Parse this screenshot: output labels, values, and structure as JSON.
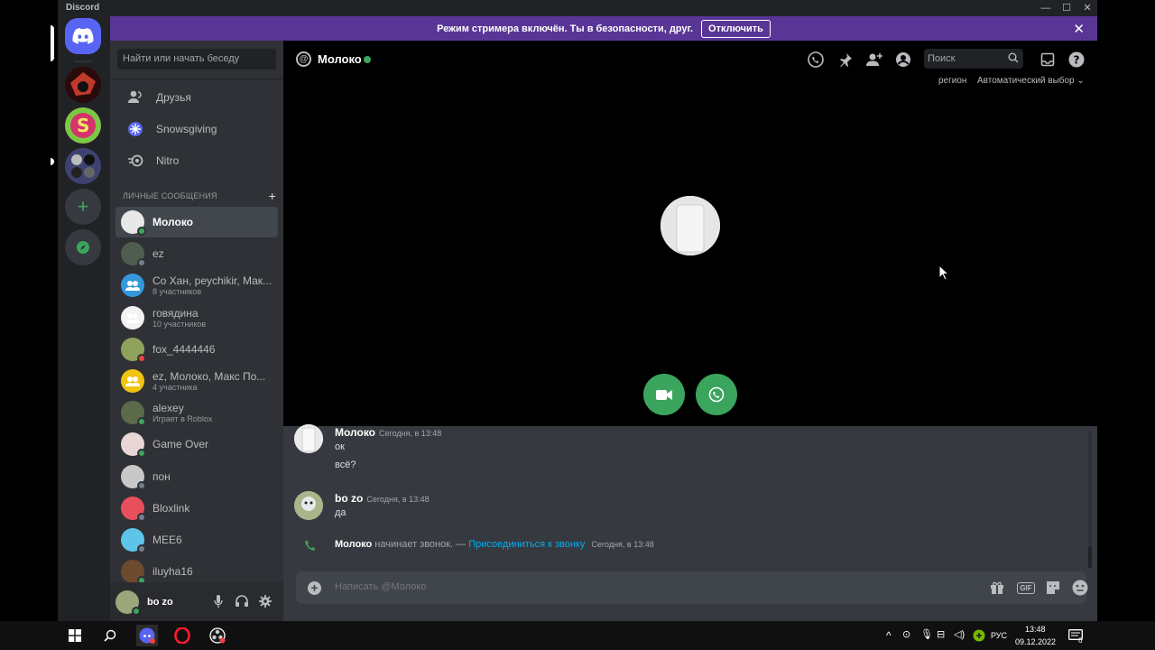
{
  "app": {
    "title": "Discord"
  },
  "banner": {
    "text": "Режим стримера включён. Ты в безопасности, друг.",
    "button": "Отключить"
  },
  "sidebar": {
    "search_placeholder": "Найти или начать беседу",
    "nav": [
      {
        "label": "Друзья",
        "icon": "friends-icon"
      },
      {
        "label": "Snowsgiving",
        "icon": "snowflake-icon"
      },
      {
        "label": "Nitro",
        "icon": "nitro-icon"
      }
    ],
    "dm_header": "ЛИЧНЫЕ СООБЩЕНИЯ",
    "dms": [
      {
        "name": "Молоко",
        "sub": "",
        "status": "online",
        "active": true,
        "color": "#e8e8e8"
      },
      {
        "name": "ez",
        "sub": "",
        "status": "offline",
        "active": false,
        "color": "#4e5d4e"
      },
      {
        "name": "Co Хан, peychikir, Мак...",
        "sub": "8 участников",
        "status": "",
        "active": false,
        "color": "#3498db"
      },
      {
        "name": "говядина",
        "sub": "10 участников",
        "status": "",
        "active": false,
        "color": "#f2f2f2"
      },
      {
        "name": "fox_4444446",
        "sub": "",
        "status": "dnd",
        "active": false,
        "color": "#8fa25b"
      },
      {
        "name": "ez, Молоко, Макс По...",
        "sub": "4 участника",
        "status": "",
        "active": false,
        "color": "#f1c40f"
      },
      {
        "name": "alexey",
        "sub": "Играет в Roblox",
        "status": "online",
        "active": false,
        "color": "#5b6b4a"
      },
      {
        "name": "Game Over",
        "sub": "",
        "status": "online",
        "active": false,
        "color": "#e9d6d6"
      },
      {
        "name": "пон",
        "sub": "",
        "status": "offline",
        "active": false,
        "color": "#c8c8c8"
      },
      {
        "name": "Bloxlink",
        "sub": "",
        "status": "offline",
        "active": false,
        "color": "#e84f5c"
      },
      {
        "name": "MEE6",
        "sub": "",
        "status": "offline",
        "active": false,
        "color": "#5ec5e8"
      },
      {
        "name": "iluyha16",
        "sub": "",
        "status": "online",
        "active": false,
        "color": "#6b4a2e"
      }
    ]
  },
  "user": {
    "name": "bo zo"
  },
  "channel": {
    "name": "Молоко"
  },
  "header": {
    "search_placeholder": "Поиск",
    "region_label": "регион",
    "region_value": "Автоматический выбор"
  },
  "messages": [
    {
      "author": "Молоко",
      "time": "Сегодня, в 13:48",
      "lines": [
        "ок",
        "всё?"
      ]
    },
    {
      "author": "bo zo",
      "time": "Сегодня, в 13:48",
      "lines": [
        "да"
      ]
    }
  ],
  "system": {
    "who": "Молоко",
    "text": " начинает звонок. — ",
    "link": "Присоединиться к звонку",
    "time": "Сегодня, в 13:48"
  },
  "composer": {
    "placeholder": "Написать @Молоко",
    "gif": "GIF"
  },
  "taskbar": {
    "lang": "РУС",
    "time": "13:48",
    "date": "09.12.2022",
    "notifications": "6"
  },
  "colors": {
    "accent": "#5865f2",
    "green": "#3ba55d",
    "streamer_banner": "#593695"
  }
}
